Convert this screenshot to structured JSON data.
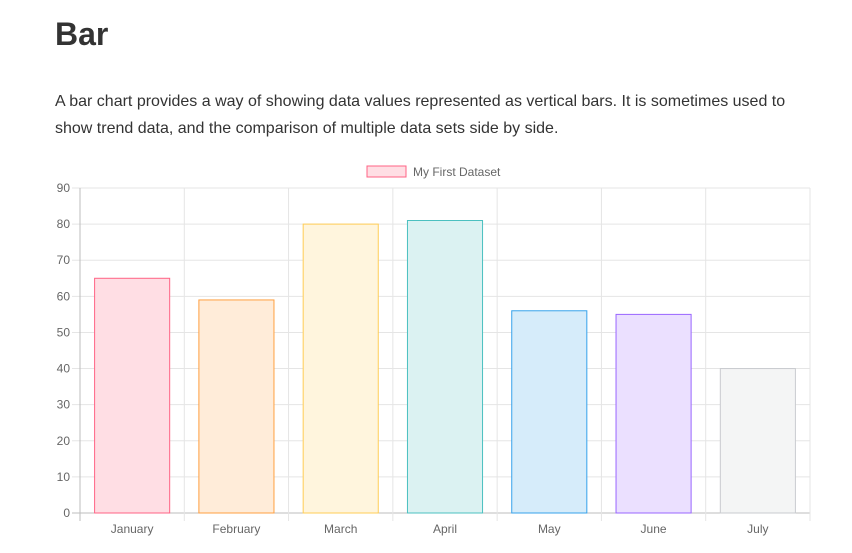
{
  "page": {
    "title": "Bar",
    "description": "A bar chart provides a way of showing data values represented as vertical bars. It is sometimes used to show trend data, and the comparison of multiple data sets side by side."
  },
  "chart_data": {
    "type": "bar",
    "categories": [
      "January",
      "February",
      "March",
      "April",
      "May",
      "June",
      "July"
    ],
    "series": [
      {
        "name": "My First Dataset",
        "values": [
          65,
          59,
          80,
          81,
          56,
          55,
          40
        ]
      }
    ],
    "bar_fill_colors": [
      "#FFDEE4",
      "#FFECD9",
      "#FFF5DD",
      "#DBF2F2",
      "#D6ECFA",
      "#EBE0FF",
      "#F4F5F5"
    ],
    "bar_border_colors": [
      "#FF6384",
      "#FF9F40",
      "#FFCD56",
      "#4BC0C0",
      "#36A2EB",
      "#9966FF",
      "#C9CBCF"
    ],
    "legend_swatch": {
      "fill": "#FFDEE4",
      "border": "#FF6384"
    },
    "yticks": [
      0,
      10,
      20,
      30,
      40,
      50,
      60,
      70,
      80,
      90
    ],
    "ylim": [
      0,
      90
    ],
    "grid": true,
    "legend_position": "top-center",
    "xlabel": "",
    "ylabel": ""
  }
}
